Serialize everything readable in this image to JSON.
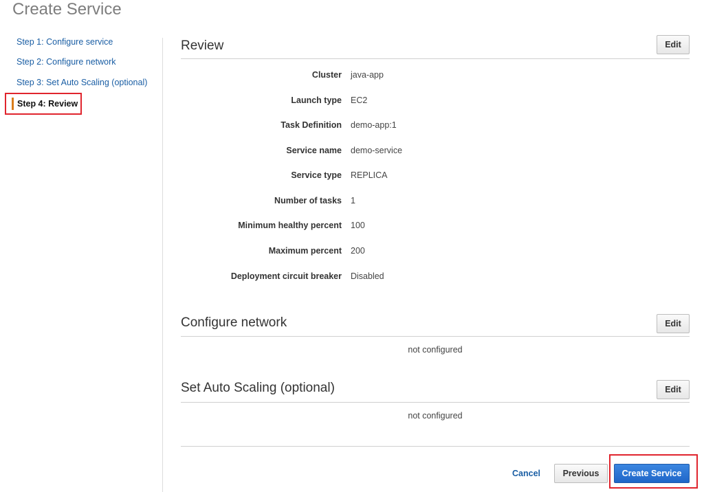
{
  "page": {
    "title": "Create Service"
  },
  "steps": [
    {
      "label": "Step 1: Configure service"
    },
    {
      "label": "Step 2: Configure network"
    },
    {
      "label": "Step 3: Set Auto Scaling (optional)"
    },
    {
      "label": "Step 4: Review",
      "active": true
    }
  ],
  "review": {
    "title": "Review",
    "edit_label": "Edit",
    "fields": [
      {
        "label": "Cluster",
        "value": "java-app"
      },
      {
        "label": "Launch type",
        "value": "EC2"
      },
      {
        "label": "Task Definition",
        "value": "demo-app:1"
      },
      {
        "label": "Service name",
        "value": "demo-service"
      },
      {
        "label": "Service type",
        "value": "REPLICA"
      },
      {
        "label": "Number of tasks",
        "value": "1"
      },
      {
        "label": "Minimum healthy percent",
        "value": "100"
      },
      {
        "label": "Maximum percent",
        "value": "200"
      },
      {
        "label": "Deployment circuit breaker",
        "value": "Disabled"
      }
    ]
  },
  "network": {
    "title": "Configure network",
    "edit_label": "Edit",
    "status": "not configured"
  },
  "autoscaling": {
    "title": "Set Auto Scaling (optional)",
    "edit_label": "Edit",
    "status": "not configured"
  },
  "footer": {
    "cancel_label": "Cancel",
    "previous_label": "Previous",
    "create_label": "Create Service"
  },
  "colors": {
    "link": "#1a5ea4",
    "primary": "#1f66c8",
    "highlight": "#e0242d",
    "active_marker": "#d97c1a"
  }
}
